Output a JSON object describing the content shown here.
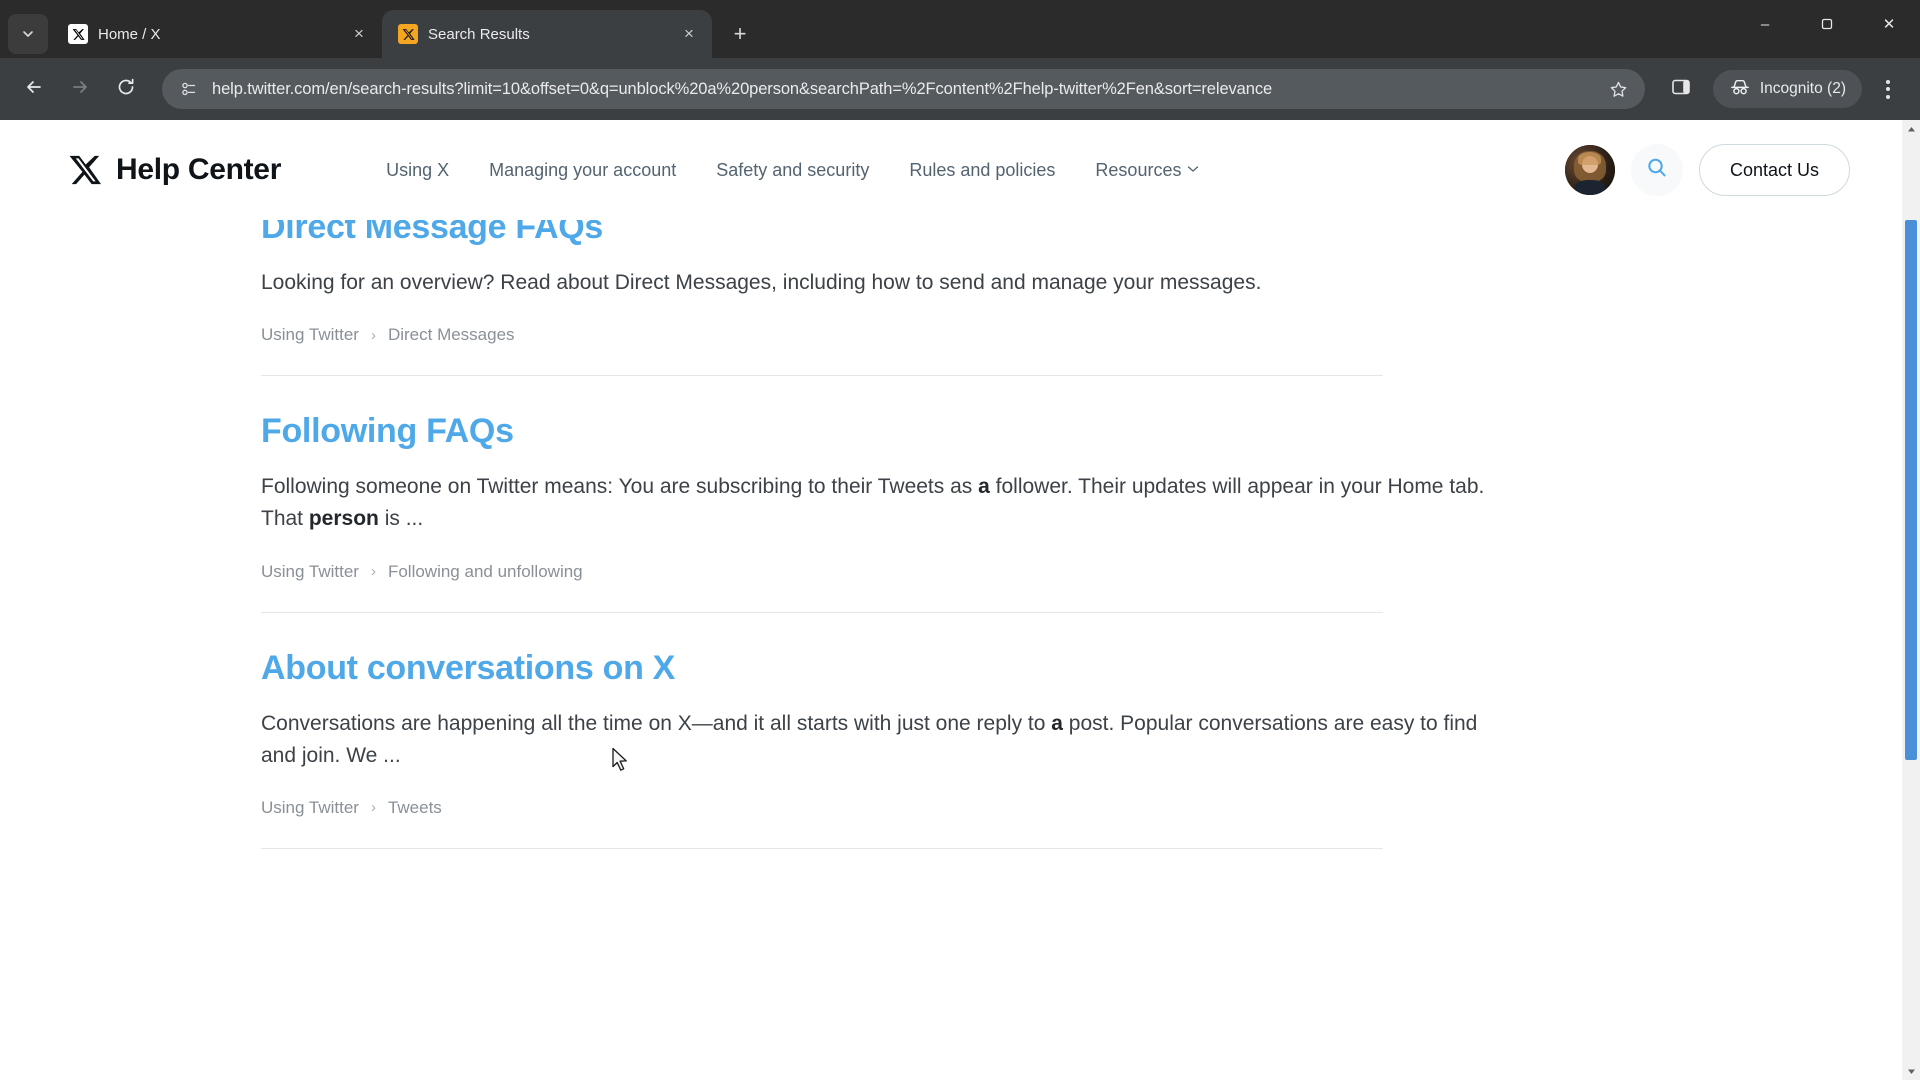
{
  "browser": {
    "tabs": [
      {
        "title": "Home / X",
        "favicon": "x-logo-icon",
        "active": false,
        "close_label": "×"
      },
      {
        "title": "Search Results",
        "favicon": "x-logo-orange-icon",
        "active": true,
        "close_label": "×"
      }
    ],
    "new_tab_label": "+",
    "tab_list_icon": "chevron-down-icon",
    "window_controls": {
      "minimize": "–",
      "maximize": "❐",
      "close": "✕"
    },
    "toolbar": {
      "back_icon": "arrow-left-icon",
      "forward_icon": "arrow-right-icon",
      "reload_icon": "reload-icon",
      "site_info_icon": "page-info-icon",
      "url": "help.twitter.com/en/search-results?limit=10&offset=0&q=unblock%20a%20person&searchPath=%2Fcontent%2Fhelp-twitter%2Fen&sort=relevance",
      "bookmark_icon": "star-icon",
      "side_panel_icon": "side-panel-icon",
      "incognito_label": "Incognito (2)",
      "incognito_icon": "incognito-hat-icon",
      "menu_icon": "kebab-menu-icon"
    }
  },
  "site": {
    "brand": {
      "logo": "x-logo-icon",
      "name": "Help Center"
    },
    "nav": [
      {
        "label": "Using X",
        "has_caret": false
      },
      {
        "label": "Managing your account",
        "has_caret": false
      },
      {
        "label": "Safety and security",
        "has_caret": false
      },
      {
        "label": "Rules and policies",
        "has_caret": false
      },
      {
        "label": "Resources",
        "has_caret": true
      }
    ],
    "avatar_name": "user-avatar",
    "search_icon": "search-icon",
    "contact_label": "Contact Us",
    "accent_color": "#4fa8e8",
    "search_icon_color": "#4fa8e8"
  },
  "results": [
    {
      "title": "Direct Message FAQs",
      "snippet_parts": [
        {
          "text": "Looking for an overview? Read about Direct Messages, including how to send and manage your messages.",
          "bold": false
        }
      ],
      "breadcrumb": [
        "Using Twitter",
        "Direct Messages"
      ],
      "separator": "›"
    },
    {
      "title": "Following FAQs",
      "snippet_parts": [
        {
          "text": "Following someone on Twitter means: You are subscribing to their Tweets as ",
          "bold": false
        },
        {
          "text": "a",
          "bold": true
        },
        {
          "text": " follower. Their updates will appear in your Home tab. That ",
          "bold": false
        },
        {
          "text": "person",
          "bold": true
        },
        {
          "text": " is ...",
          "bold": false
        }
      ],
      "breadcrumb": [
        "Using Twitter",
        "Following and unfollowing"
      ],
      "separator": "›"
    },
    {
      "title": "About conversations on X",
      "snippet_parts": [
        {
          "text": "Conversations are happening all the time on X—and it all starts with just one reply to ",
          "bold": false
        },
        {
          "text": "a",
          "bold": true
        },
        {
          "text": " post. Popular conversations are easy to find and join. We ...",
          "bold": false
        }
      ],
      "breadcrumb": [
        "Using Twitter",
        "Tweets"
      ],
      "separator": "›"
    }
  ]
}
